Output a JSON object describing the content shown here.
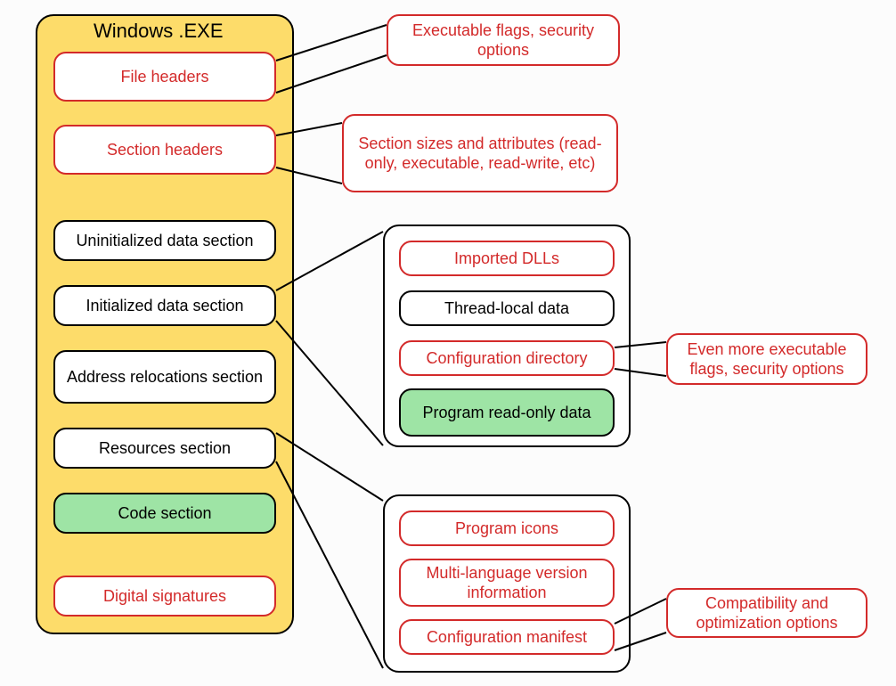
{
  "diagram": {
    "title": "Windows .EXE",
    "main_sections": {
      "file_headers": "File headers",
      "section_headers": "Section headers",
      "uninit_data": "Uninitialized data section",
      "init_data": "Initialized data section",
      "addr_reloc": "Address relocations section",
      "resources": "Resources section",
      "code": "Code section",
      "digital_sig": "Digital signatures"
    },
    "annotations": {
      "file_headers_note": "Executable flags, security options",
      "section_headers_note": "Section sizes and attributes (read-only, executable, read-write, etc)",
      "config_dir_note": "Even more executable flags, security options",
      "manifest_note": "Compatibility and optimization options"
    },
    "init_data_expansion": {
      "imported_dlls": "Imported DLLs",
      "thread_local": "Thread-local data",
      "config_dir": "Configuration directory",
      "readonly_data": "Program read-only data"
    },
    "resources_expansion": {
      "icons": "Program icons",
      "version_info": "Multi-language version information",
      "manifest": "Configuration manifest"
    }
  }
}
